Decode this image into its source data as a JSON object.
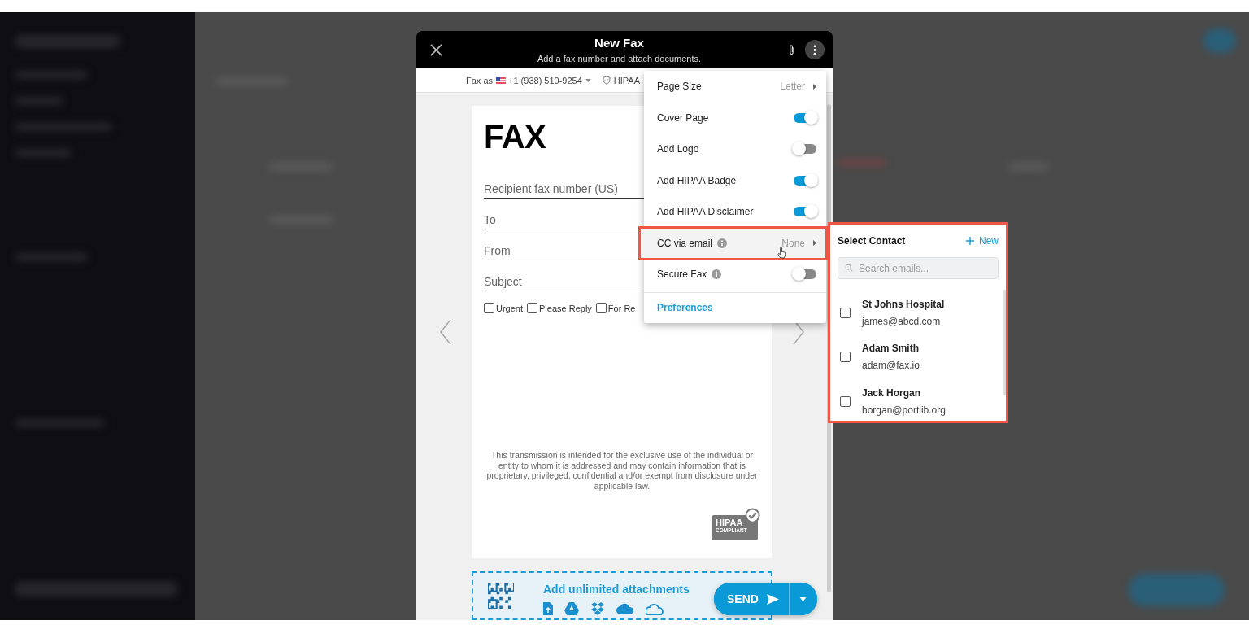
{
  "modal": {
    "title": "New Fax",
    "subtitle": "Add a fax number and attach documents.",
    "fax_as_label": "Fax as",
    "fax_number": "+1 (938) 510-9254",
    "hipaa_label": "HIPAA"
  },
  "document": {
    "heading": "FAX",
    "fields": [
      {
        "placeholder": "Recipient fax number (US)"
      },
      {
        "placeholder": "To"
      },
      {
        "placeholder": "From"
      },
      {
        "placeholder": "Subject"
      }
    ],
    "checkboxes": [
      {
        "label": "Urgent",
        "checked": false
      },
      {
        "label": "Please Reply",
        "checked": false
      },
      {
        "label": "For Re",
        "checked": false
      }
    ],
    "disclaimer": "This transmission is intended for the exclusive use of the individual or entity to whom it is addressed and may contain information that is proprietary, privileged, confidential and/or exempt from disclosure under applicable law.",
    "badge": {
      "line_1": "HIPAA",
      "line_2": "COMPLIANT"
    }
  },
  "attachments": {
    "label": "Add unlimited attachments"
  },
  "send_button": {
    "label": "SEND"
  },
  "menu": {
    "items": [
      {
        "kind": "value",
        "label": "Page Size",
        "value": "Letter",
        "info": false,
        "selected": false
      },
      {
        "kind": "toggle",
        "label": "Cover Page",
        "on": true,
        "info": false,
        "selected": false
      },
      {
        "kind": "toggle",
        "label": "Add Logo",
        "on": false,
        "info": false,
        "selected": false
      },
      {
        "kind": "toggle",
        "label": "Add HIPAA Badge",
        "on": true,
        "info": false,
        "selected": false
      },
      {
        "kind": "toggle",
        "label": "Add HIPAA Disclaimer",
        "on": true,
        "info": false,
        "selected": false
      },
      {
        "kind": "value",
        "label": "CC via email",
        "value": "None",
        "info": true,
        "selected": true
      },
      {
        "kind": "toggle",
        "label": "Secure Fax",
        "on": false,
        "info": true,
        "selected": false
      }
    ],
    "footer_link": "Preferences"
  },
  "contact_panel": {
    "highlighted": true,
    "title": "Select Contact",
    "new_label": "New",
    "search_placeholder": "Search emails...",
    "contacts": [
      {
        "name": "St Johns Hospital",
        "email": "james@abcd.com",
        "checked": false
      },
      {
        "name": "Adam Smith",
        "email": "adam@fax.io",
        "checked": false
      },
      {
        "name": "Jack Horgan",
        "email": "horgan@portlib.org",
        "checked": false
      }
    ]
  }
}
